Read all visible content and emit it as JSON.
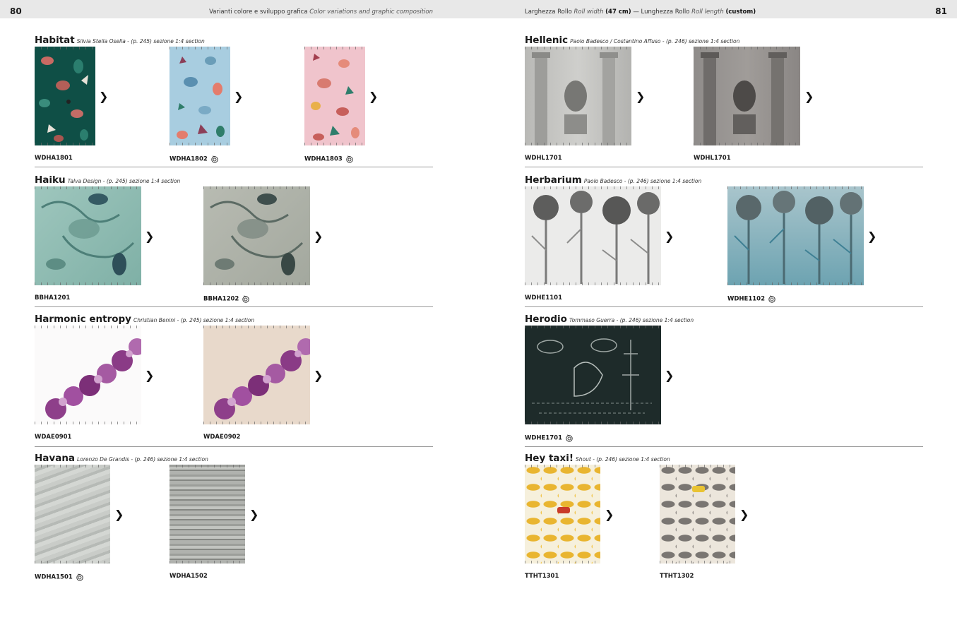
{
  "pages": {
    "left_number": "80",
    "right_number": "81"
  },
  "header": {
    "left_it": "Varianti colore e sviluppo grafica",
    "left_en": "Color variations and graphic composition",
    "right_it1": "Larghezza Rollo",
    "right_en1": "Roll width",
    "right_val1": "(47 cm)",
    "right_dash": "—",
    "right_it2": "Lunghezza Rollo",
    "right_en2": "Roll length",
    "right_val2": "(custom)"
  },
  "sections": [
    {
      "name": "Habitat",
      "subtitle": "Silvia Stella Osella - (p. 245) sezione 1:4 section",
      "swatches": [
        {
          "code": "WDHA1801",
          "roll": false
        },
        {
          "code": "WDHA1802",
          "roll": true
        },
        {
          "code": "WDHA1803",
          "roll": true
        }
      ]
    },
    {
      "name": "Haiku",
      "subtitle": "Talva Design - (p. 245) sezione 1:4 section",
      "swatches": [
        {
          "code": "BBHA1201",
          "roll": false
        },
        {
          "code": "BBHA1202",
          "roll": true
        }
      ]
    },
    {
      "name": "Harmonic entropy",
      "subtitle": "Christian Benini - (p. 245) sezione 1:4 section",
      "swatches": [
        {
          "code": "WDAE0901",
          "roll": false
        },
        {
          "code": "WDAE0902",
          "roll": false
        }
      ]
    },
    {
      "name": "Havana",
      "subtitle": "Lorenzo De Grandis - (p. 246) sezione 1:4 section",
      "swatches": [
        {
          "code": "WDHA1501",
          "roll": true
        },
        {
          "code": "WDHA1502",
          "roll": false
        }
      ]
    },
    {
      "name": "Hellenic",
      "subtitle": "Paolo Badesco / Costantino Affuso - (p. 246) sezione 1:4 section",
      "swatches": [
        {
          "code": "WDHL1701",
          "roll": false
        },
        {
          "code": "WDHL1701",
          "roll": false
        }
      ]
    },
    {
      "name": "Herbarium",
      "subtitle": "Paolo Badesco - (p. 246) sezione 1:4 section",
      "swatches": [
        {
          "code": "WDHE1101",
          "roll": false
        },
        {
          "code": "WDHE1102",
          "roll": true
        }
      ]
    },
    {
      "name": "Herodio",
      "subtitle": "Tommaso Guerra - (p. 246) sezione 1:4 section",
      "swatches": [
        {
          "code": "WDHE1701",
          "roll": true
        }
      ]
    },
    {
      "name": "Hey taxi!",
      "subtitle": "Shout - (p. 246) sezione 1:4 section",
      "swatches": [
        {
          "code": "TTHT1301",
          "roll": false
        },
        {
          "code": "TTHT1302",
          "roll": false
        }
      ]
    }
  ],
  "icons": {
    "next": "chevron-right-icon",
    "roll": "roll-spiral-icon"
  }
}
